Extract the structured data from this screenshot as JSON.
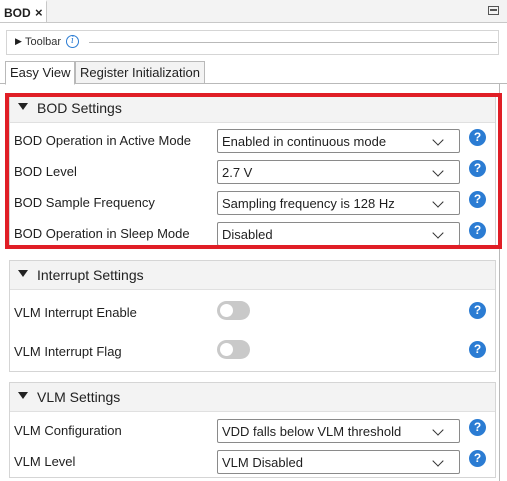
{
  "window": {
    "tab_label": "BOD",
    "close_glyph": "×"
  },
  "toolbar": {
    "label": "Toolbar",
    "info_glyph": "i"
  },
  "tabs": [
    {
      "label": "Easy View",
      "active": true
    },
    {
      "label": "Register Initialization",
      "active": false
    }
  ],
  "sections": {
    "bod": {
      "title": "BOD Settings",
      "rows": [
        {
          "label": "BOD Operation in Active Mode",
          "value": "Enabled in continuous mode"
        },
        {
          "label": "BOD Level",
          "value": "2.7 V"
        },
        {
          "label": "BOD Sample Frequency",
          "value": "Sampling frequency is 128 Hz"
        },
        {
          "label": "BOD Operation in Sleep Mode",
          "value": "Disabled"
        }
      ]
    },
    "interrupt": {
      "title": "Interrupt Settings",
      "rows": [
        {
          "label": "VLM Interrupt Enable",
          "enabled": false
        },
        {
          "label": "VLM Interrupt Flag",
          "enabled": false
        }
      ]
    },
    "vlm": {
      "title": "VLM Settings",
      "rows": [
        {
          "label": "VLM Configuration",
          "value": "VDD falls below VLM threshold"
        },
        {
          "label": "VLM Level",
          "value": "VLM Disabled"
        }
      ]
    }
  },
  "help_glyph": "?",
  "colors": {
    "highlight": "#e01e26",
    "help": "#2b7cd3",
    "toggle_off": "#c9c9c9"
  }
}
